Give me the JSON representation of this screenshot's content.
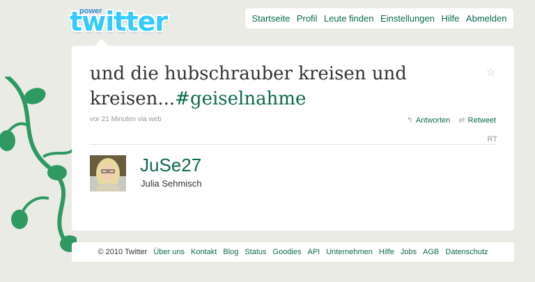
{
  "logo": {
    "power": "power",
    "word": "twitter"
  },
  "nav": [
    "Startseite",
    "Profil",
    "Leute finden",
    "Einstellungen",
    "Hilfe",
    "Abmelden"
  ],
  "tweet": {
    "text": "und die hubschrauber kreisen und kreisen...",
    "hashtag": "#geiselnahme",
    "time": "vor 21 Minuten",
    "via_word": "via",
    "source": "web",
    "reply_label": "Antworten",
    "retweet_label": "Retweet",
    "rt_label": "RT"
  },
  "user": {
    "screen_name": "JuSe27",
    "name": "Julia Sehmisch"
  },
  "footer": {
    "copyright": "© 2010 Twitter",
    "links": [
      "Über uns",
      "Kontakt",
      "Blog",
      "Status",
      "Goodies",
      "API",
      "Unternehmen",
      "Hilfe",
      "Jobs",
      "AGB",
      "Datenschutz"
    ]
  },
  "colors": {
    "accent": "#0b6b46",
    "background": "#ebebe6",
    "logo_blue": "#33ccff"
  },
  "icons": {
    "star": "star-icon",
    "reply": "reply-icon",
    "retweet": "retweet-icon"
  }
}
